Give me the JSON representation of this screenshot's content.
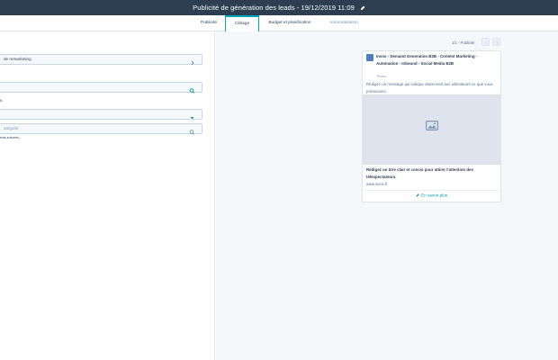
{
  "header": {
    "title": "Publicité de génération des leads - 19/12/2019 11:09"
  },
  "tabs": [
    {
      "label": "Publicité",
      "state": "default"
    },
    {
      "label": "Ciblage",
      "state": "active"
    },
    {
      "label": "Budget et planification",
      "state": "default"
    },
    {
      "label": "Automatisation",
      "state": "muted"
    }
  ],
  "targeting": {
    "remarketing_label": "de remarketing",
    "search_value": "",
    "section_letter": "s",
    "dropdown_value": "",
    "category_placeholder": "atégorie",
    "note": "ents suivants :"
  },
  "preview": {
    "pager_text": "1/1 - Publicité",
    "ad_title": "Invox - Demand Generation B2B - Content Marketing - Automation - Inbound - Social Media B2B",
    "promo_label": "Promu",
    "message": "Rédigez un message qui indique clairement aux utilisateurs ce que vous promouvez.",
    "headline": "Rédigez un titre clair et concis pour attirer l'attention des téléspectateurs.",
    "domain": "www.invox.fr",
    "cta_label": "En savoir plus"
  },
  "colors": {
    "topbar": "#2d3e50",
    "accent": "#00a4bd",
    "link": "#0091ae",
    "right_pane_bg": "#f5f8fa"
  },
  "icons": [
    "pencil-icon",
    "chevron-right-icon",
    "search-icon",
    "caret-down-icon",
    "chevron-left-icon",
    "image-icon"
  ]
}
